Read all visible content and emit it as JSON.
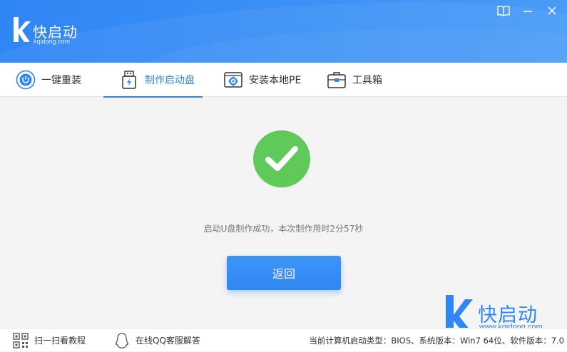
{
  "app": {
    "brand_name": "快启动",
    "brand_domain": "kqidong.com",
    "accent_color": "#2f86f5",
    "success_color": "#5fc95a"
  },
  "window_controls": {
    "icons": [
      "book-icon",
      "minimize-icon",
      "close-icon"
    ]
  },
  "tabs": [
    {
      "label": "一键重装",
      "icon": "power-icon",
      "active": false
    },
    {
      "label": "制作启动盘",
      "icon": "usb-drive-icon",
      "active": true
    },
    {
      "label": "安装本地PE",
      "icon": "gear-box-icon",
      "active": false
    },
    {
      "label": "工具箱",
      "icon": "toolbox-icon",
      "active": false
    }
  ],
  "main": {
    "message": "启动U盘制作成功，本次制作用时2分57秒",
    "back_label": "返回"
  },
  "watermark": {
    "text": "快启动",
    "domain": "www.kqidong.com"
  },
  "footer": {
    "scan_tutorial": "扫一扫看教程",
    "online_help": "在线QQ客服解答",
    "status": "当前计算机启动类型：BIOS、系统版本：Win7 64位、软件版本：7.0"
  }
}
